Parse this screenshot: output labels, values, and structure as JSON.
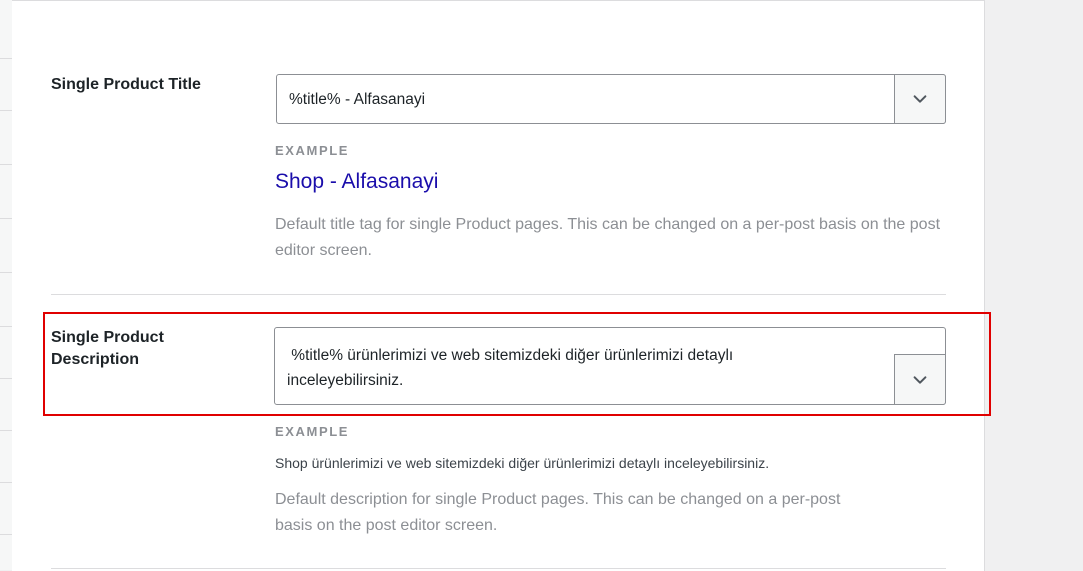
{
  "title_row": {
    "label": "Single Product Title",
    "value": "%title% - Alfasanayi",
    "example_label": "EXAMPLE",
    "example_value": "Shop - Alfasanayi",
    "help": "Default title tag for single Product pages. This can be changed on a per-post basis on the post editor screen."
  },
  "description_row": {
    "label_line1": "Single Product",
    "label_line2": "Description",
    "value_line1": " %title% ürünlerimizi ve web sitemizdeki diğer ürünlerimizi detaylı",
    "value_line2": "inceleyebilirsiniz.",
    "example_label": "EXAMPLE",
    "example_value": "Shop ürünlerimizi ve web sitemizdeki diğer ürünlerimizi detaylı inceleyebilirsiniz.",
    "help_line1": "Default description for single Product pages. This can be changed on a per-post",
    "help_line2": "basis on the post editor screen."
  },
  "icons": {
    "dropdown": "chevron-down-icon"
  },
  "colors": {
    "highlight": "#e00000",
    "example_link": "#1a0dab"
  }
}
